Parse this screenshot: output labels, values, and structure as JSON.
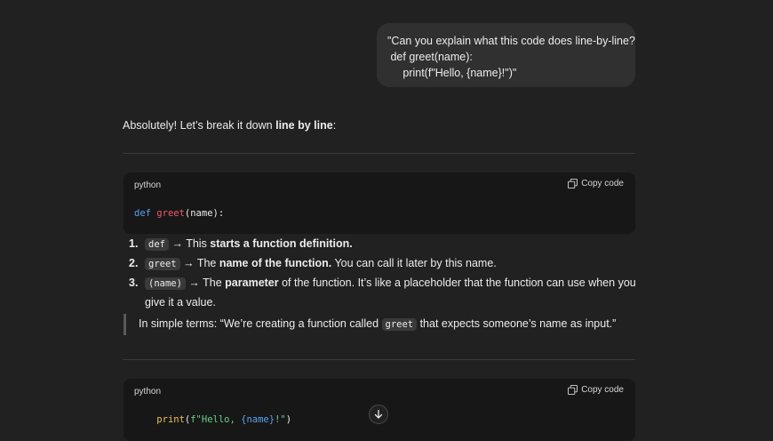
{
  "user_message": {
    "lines": [
      "\"Can you explain what this code does line-by-line?",
      " def greet(name):",
      "     print(f\"Hello, {name}!\")\""
    ]
  },
  "assistant": {
    "intro_prefix": "Absolutely! Let’s break it down ",
    "intro_bold": "line by line",
    "intro_suffix": ":",
    "code_blocks": [
      {
        "lang": "python",
        "copy_label": "Copy code",
        "tokens": {
          "kw": "def",
          "sp": " ",
          "fn": "greet",
          "rest": "(name):"
        }
      },
      {
        "lang": "python",
        "copy_label": "Copy code",
        "tokens": {
          "indent": "    ",
          "fn": "print",
          "open": "(",
          "str1": "f\"Hello, ",
          "interp": "{name}",
          "str2": "!\"",
          "close": ")"
        }
      }
    ],
    "list": [
      {
        "num": "1.",
        "code": "def",
        "pre": " → This ",
        "bold": "starts a function definition.",
        "post": ""
      },
      {
        "num": "2.",
        "code": "greet",
        "pre": " → The ",
        "bold": "name of the function.",
        "post": " You can call it later by this name."
      },
      {
        "num": "3.",
        "code": "(name)",
        "pre": " → The ",
        "bold": "parameter",
        "post": " of the function. It’s like a placeholder that the function can use when you give it a value."
      }
    ],
    "quote": {
      "pre": "In simple terms: “We’re creating a function called ",
      "code": "greet",
      "post": " that expects someone’s name as input.”"
    }
  },
  "icons": {
    "copy": "copy-icon",
    "scroll_down": "arrow-down-icon"
  }
}
